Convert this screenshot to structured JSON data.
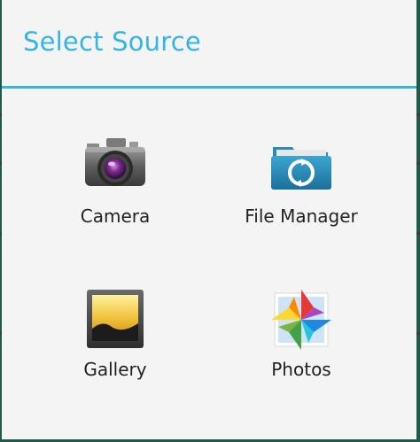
{
  "dialog": {
    "title": "Select Source",
    "accent_color": "#33b5e5"
  },
  "options": [
    {
      "label": "Camera",
      "icon": "camera-icon"
    },
    {
      "label": "File Manager",
      "icon": "folder-icon"
    },
    {
      "label": "Gallery",
      "icon": "gallery-icon"
    },
    {
      "label": "Photos",
      "icon": "photos-pinwheel-icon"
    }
  ]
}
